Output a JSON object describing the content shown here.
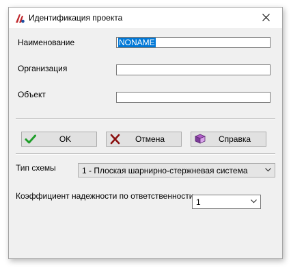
{
  "window": {
    "title": "Идентификация проекта"
  },
  "fields": {
    "name": {
      "label": "Наименование",
      "value": "NONAME"
    },
    "organization": {
      "label": "Организация",
      "value": ""
    },
    "object": {
      "label": "Объект",
      "value": ""
    }
  },
  "buttons": {
    "ok": "OK",
    "cancel": "Отмена",
    "help": "Справка"
  },
  "scheme": {
    "label": "Тип схемы",
    "selected": "1 - Плоская шарнирно-стержневая система"
  },
  "reliability": {
    "label": "Коэффициент надежности по ответственности",
    "selected": "1"
  },
  "icons": {
    "app": "app-logo-icon",
    "close": "close-icon",
    "ok": "green-checkmark-icon",
    "cancel": "red-cross-icon",
    "help": "help-book-icon",
    "dropdown": "chevron-down-icon"
  }
}
